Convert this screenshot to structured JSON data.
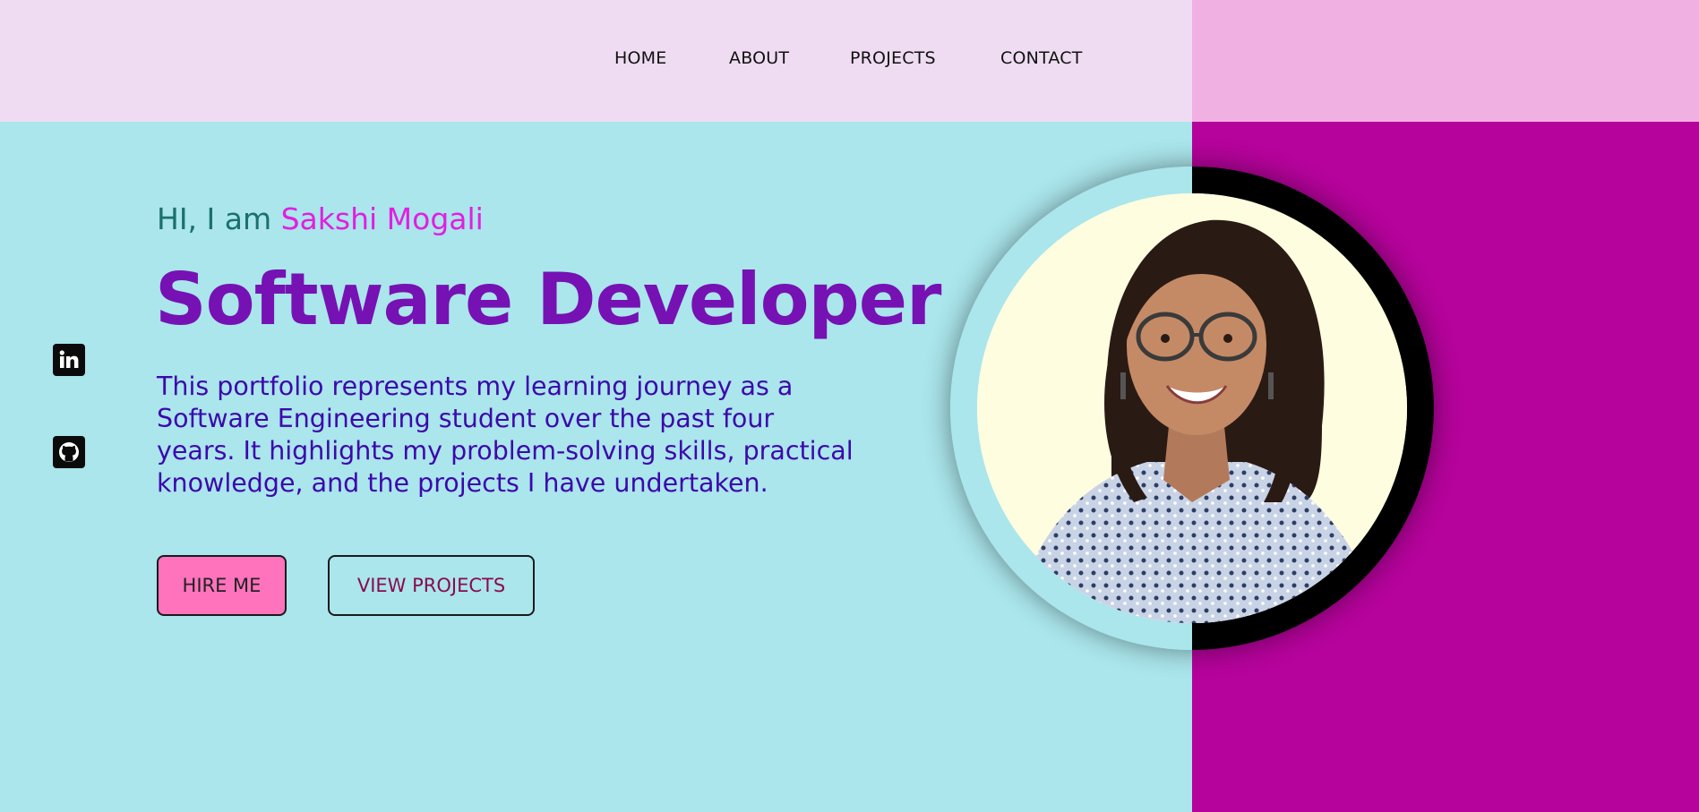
{
  "nav": {
    "items": [
      {
        "label": "HOME"
      },
      {
        "label": "ABOUT"
      },
      {
        "label": "PROJECTS"
      },
      {
        "label": "CONTACT"
      }
    ]
  },
  "social": [
    {
      "icon": "linkedin-icon"
    },
    {
      "icon": "github-icon"
    }
  ],
  "hero": {
    "greeting_prefix": "HI, I am ",
    "name": "Sakshi Mogali",
    "headline": "Software Developer",
    "description": "This portfolio represents my learning journey as a Software Engineering student over the past four years. It highlights my problem-solving skills, practical knowledge, and the projects I have undertaken.",
    "buttons": {
      "hire": "HIRE ME",
      "view_projects": "VIEW PROJECTS"
    }
  },
  "colors": {
    "nav_bg": "#efdcf2",
    "nav_right_bg": "#f0b0e2",
    "hero_bg": "#aae6ec",
    "accent_right": "#b5039b",
    "name_color": "#e31ee0",
    "headline_color": "#7611b4",
    "description_color": "#3d08ad",
    "hire_button_bg": "#ff73bd"
  }
}
